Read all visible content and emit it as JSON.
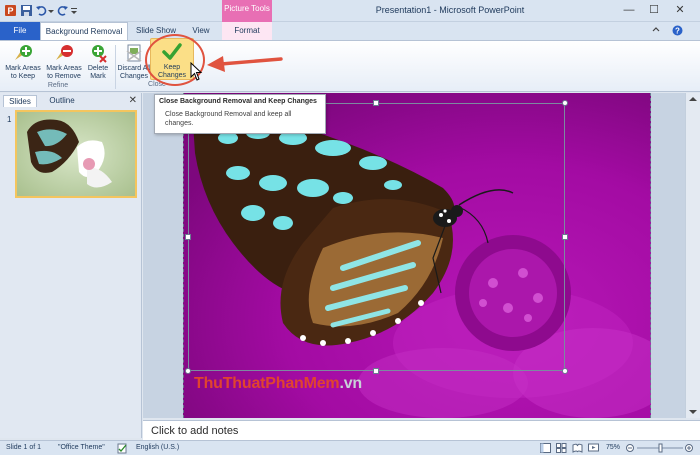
{
  "window": {
    "title": "Presentation1 - Microsoft PowerPoint",
    "context_tab": "Picture Tools",
    "controls": {
      "minimize": "—",
      "restore": "☐",
      "close": "✕"
    }
  },
  "tabs": [
    "File",
    "Background Removal",
    "Slide Show",
    "View",
    "Format"
  ],
  "ribbon": {
    "refine": {
      "label": "Refine",
      "mark_keep": "Mark Areas to Keep",
      "mark_remove": "Mark Areas to Remove",
      "delete_mark": "Delete Mark"
    },
    "close": {
      "label": "Close",
      "discard": "Discard All Changes",
      "keep": "Keep Changes"
    }
  },
  "tooltip": {
    "title": "Close Background Removal and Keep Changes",
    "description": "Close Background Removal and keep all changes."
  },
  "pane": {
    "tab_slides": "Slides",
    "tab_outline": "Outline",
    "close": "✕",
    "slide_number": "1"
  },
  "watermark": {
    "part1": "ThuThuat",
    "part2": "PhanMem",
    "part3": ".vn"
  },
  "notes": {
    "placeholder": "Click to add notes"
  },
  "status": {
    "slide": "Slide 1 of 1",
    "theme": "\"Office Theme\"",
    "language": "English (U.S.)",
    "zoom": "75%"
  },
  "colors": {
    "accent": "#2a62c9",
    "removal_overlay": "#a30ba3",
    "highlight": "#e0533f",
    "picture_tools": "#e86fb4"
  }
}
